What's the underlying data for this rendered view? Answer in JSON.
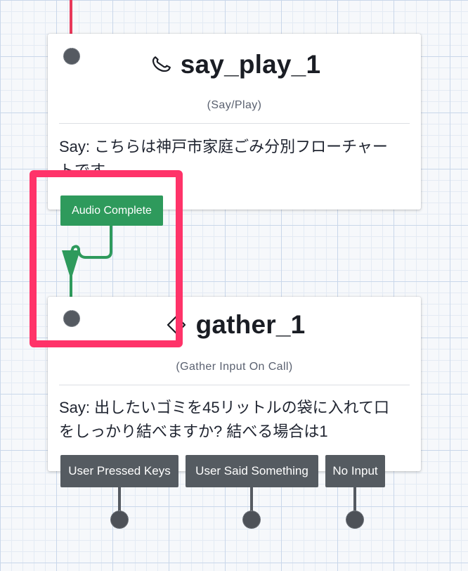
{
  "widgets": [
    {
      "name": "say_play_1",
      "type": "(Say/Play)",
      "body": "Say: こちらは神戸市家庭ごみ分別フローチャートです。",
      "icon": "phone-icon",
      "transitions": [
        "Audio Complete"
      ]
    },
    {
      "name": "gather_1",
      "type": "(Gather Input On Call)",
      "body": "Say: 出したいゴミを45リットルの袋に入れて口をしっかり結べますか? 結べる場合は1",
      "icon": "phone-icon",
      "transitions": [
        "User Pressed Keys",
        "User Said Something",
        "No Input"
      ]
    }
  ],
  "colors": {
    "incoming_wire": "#e8385a",
    "connected_wire": "#2e9a5c",
    "transition_connected": "#2e9a5c",
    "transition_idle": "#555b61",
    "highlight": "#ff3369"
  }
}
